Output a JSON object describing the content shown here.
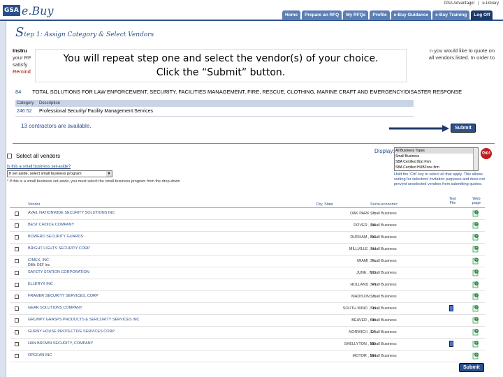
{
  "header": {
    "logo_box": "GSA",
    "logo_text": "e.Buy",
    "top_links": [
      "GSA Advantage!",
      "|",
      "e-Library"
    ],
    "tabs": [
      "Home",
      "Prepare an RFQ",
      "My RFQs",
      "Profile",
      "e-Buy Guidance",
      "e-Buy Training",
      "Log Off"
    ]
  },
  "step": {
    "big_letter": "S",
    "rest": "tep 1: Assign Category & Select Vendors"
  },
  "instructions": {
    "line1_bold": "Instru",
    "line1_end": "n you would like to quote on",
    "line2_start": "your RF",
    "line2_end": "all vendors listed. In order to",
    "line3_start": "satisfy",
    "line4_start": "Remind"
  },
  "callout": {
    "line1": "You will repeat step one and select the vendor(s) of your choice.",
    "line2": "Click the “Submit” button."
  },
  "category_line": {
    "code": "84",
    "text": "TOTAL SOLUTIONS FOR LAW ENFORCEMENT, SECURITY, FACILITIES MANAGEMENT, FIRE, RESCUE, CLOTHING, MARINE CRAFT AND EMERGENCY/DISASTER RESPONSE"
  },
  "category_table": {
    "headers": [
      "Category",
      "Description"
    ],
    "row": {
      "code": "246 52",
      "description": "Professional Security/ Facility Management Services"
    }
  },
  "contractors_available": "13 contractors are available.",
  "submit_label": "Submit",
  "select_all_label": "Select all vendors",
  "setaside": {
    "question": "Is this a small business set-aside?",
    "select_value": "If set aside, select small business program",
    "note": "* If this is a small business set-aside, you must select the small business program from the drop-down"
  },
  "display": {
    "label": "Display:",
    "options": [
      "All Business Types",
      "Small Business",
      "SBA Certified 8(a) Firm",
      "SBA Certified HUBZone firm"
    ],
    "go_label": "Go!",
    "help": "Hold the 'Ctrl' key to select all that apply. This allows sorting for selection/ invitation purposes and does not prevent unselected vendors from submitting quotes."
  },
  "vendor_table": {
    "headers": {
      "vendor": "Vendor",
      "city_state": "City, State",
      "socio": "Socio-economic",
      "text_file": "Text File",
      "web_page": "Web page"
    },
    "rows": [
      {
        "name": "AVAIL NATIONWIDE SECURITY SOLUTIONS INC",
        "sub": "",
        "city": "OAK PARK , IL",
        "socio": "Small Business",
        "doc": false
      },
      {
        "name": "BEST CHOICE COMPANY",
        "sub": "",
        "city": "DOVER , DE",
        "socio": "Small Business",
        "doc": false
      },
      {
        "name": "BOWERD SECURITY GUARDS",
        "sub": "",
        "city": "DURHAM , NC",
        "socio": "Small Business",
        "doc": false
      },
      {
        "name": "BRIGHT LIGHTS SECURITY CORP",
        "sub": "",
        "city": "MILLVILLE , NJ",
        "socio": "Small Business",
        "doc": false
      },
      {
        "name": "CIMEX, INC",
        "sub": "DBA: DEF Inc.",
        "city": "MIAMI , FL",
        "socio": "Small Business",
        "doc": false
      },
      {
        "name": "SAFETY STATION CORPORATION",
        "sub": "",
        "city": "JUNE , MO",
        "socio": "Small Business",
        "doc": false
      },
      {
        "name": "ELLERYX INC",
        "sub": "",
        "city": "HOLLAND , MI",
        "socio": "Small Business",
        "doc": false
      },
      {
        "name": "FRAMER SECURITY SERVICES, CORP",
        "sub": "",
        "city": "MADISON , IL",
        "socio": "Small Business",
        "doc": false
      },
      {
        "name": "GEAR SOLUTIONS COMPANY",
        "sub": "",
        "city": "SOUTH WIND , TN",
        "socio": "Small Business",
        "doc": true
      },
      {
        "name": "GRUMPY GRASPS PRODUCTS & SERCURITY SERVICES INC",
        "sub": "",
        "city": "BEAVER , OR",
        "socio": "Small Business",
        "doc": false
      },
      {
        "name": "GURNY HOUSE PROTECTIVE SERVICES CORP",
        "sub": "",
        "city": "NORWICH , CT",
        "socio": "Small Business",
        "doc": false
      },
      {
        "name": "HAN BROWN SECURITY, COMPANY",
        "sub": "",
        "city": "SHELLYTON , MD",
        "socio": "Small Business",
        "doc": true
      },
      {
        "name": "OPECAN INC",
        "sub": "",
        "city": "MOTOR , MN",
        "socio": "Small Business",
        "doc": false
      }
    ]
  },
  "colors": {
    "brand": "#2b4f8a",
    "tab": "#5b7fb5",
    "go": "#c21c1c"
  }
}
